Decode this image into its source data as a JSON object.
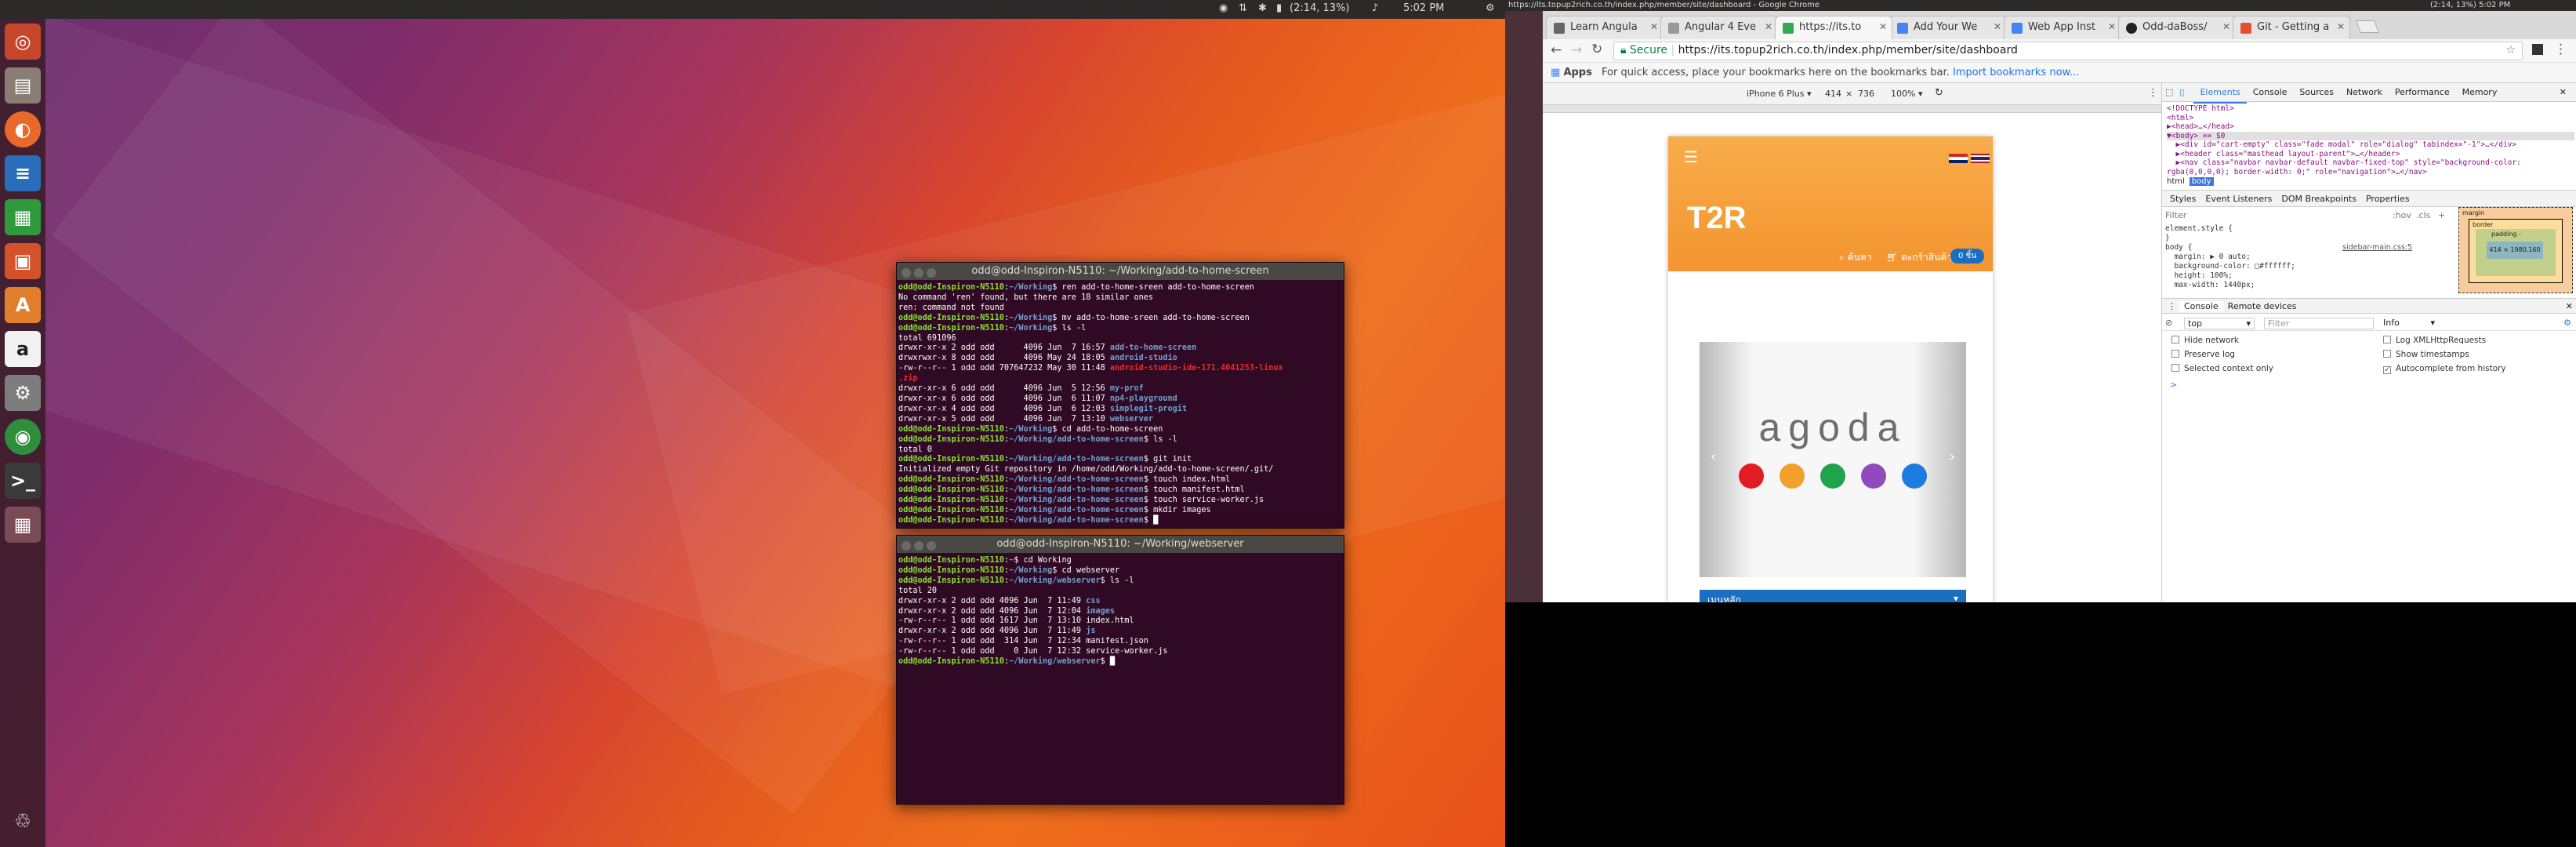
{
  "desktop": {
    "topbar": {
      "indicators": [
        "(2:14, 13%)",
        "5:02 PM"
      ]
    },
    "launcher_icons": [
      "dash-icon",
      "files-icon",
      "firefox-icon",
      "writer-icon",
      "calc-icon",
      "impress-icon",
      "software-center-icon",
      "amazon-icon",
      "settings-icon",
      "chrome-icon",
      "terminal-icon",
      "workspace-icon",
      "trash-icon"
    ]
  },
  "terminals": [
    {
      "title": "odd@odd-Inspiron-N5110: ~/Working/add-to-home-screen",
      "lines": [
        [
          {
            "c": "g",
            "t": "odd@odd-Inspiron-N5110"
          },
          {
            "t": ":"
          },
          {
            "c": "b",
            "t": "~/Working"
          },
          {
            "t": "$ ren add-to-home-sreen add-to-home-screen"
          }
        ],
        [
          {
            "t": "No command 'ren' found, but there are 18 similar ones"
          }
        ],
        [
          {
            "t": "ren: command not found"
          }
        ],
        [
          {
            "c": "g",
            "t": "odd@odd-Inspiron-N5110"
          },
          {
            "t": ":"
          },
          {
            "c": "b",
            "t": "~/Working"
          },
          {
            "t": "$ mv add-to-home-sreen add-to-home-screen"
          }
        ],
        [
          {
            "c": "g",
            "t": "odd@odd-Inspiron-N5110"
          },
          {
            "t": ":"
          },
          {
            "c": "b",
            "t": "~/Working"
          },
          {
            "t": "$ ls -l"
          }
        ],
        [
          {
            "t": "total 691096"
          }
        ],
        [
          {
            "t": "drwxr-xr-x 2 odd odd      4096 Jun  7 16:57 "
          },
          {
            "c": "b",
            "t": "add-to-home-screen"
          }
        ],
        [
          {
            "t": "drwxrwxr-x 8 odd odd      4096 May 24 18:05 "
          },
          {
            "c": "b",
            "t": "android-studio"
          }
        ],
        [
          {
            "t": "-rw-r--r-- 1 odd odd 707647232 May 30 11:48 "
          },
          {
            "c": "r",
            "t": "android-studio-ide-171.4041253-linux"
          }
        ],
        [
          {
            "c": "r",
            "t": ".zip"
          }
        ],
        [
          {
            "t": "drwxr-xr-x 6 odd odd      4096 Jun  5 12:56 "
          },
          {
            "c": "b",
            "t": "my-prof"
          }
        ],
        [
          {
            "t": "drwxr-xr-x 6 odd odd      4096 Jun  6 11:07 "
          },
          {
            "c": "b",
            "t": "np4-playground"
          }
        ],
        [
          {
            "t": "drwxr-xr-x 4 odd odd      4096 Jun  6 12:03 "
          },
          {
            "c": "b",
            "t": "simplegit-progit"
          }
        ],
        [
          {
            "t": "drwxr-xr-x 5 odd odd      4096 Jun  7 13:10 "
          },
          {
            "c": "b",
            "t": "webserver"
          }
        ],
        [
          {
            "c": "g",
            "t": "odd@odd-Inspiron-N5110"
          },
          {
            "t": ":"
          },
          {
            "c": "b",
            "t": "~/Working"
          },
          {
            "t": "$ cd add-to-home-screen"
          }
        ],
        [
          {
            "c": "g",
            "t": "odd@odd-Inspiron-N5110"
          },
          {
            "t": ":"
          },
          {
            "c": "b",
            "t": "~/Working/add-to-home-screen"
          },
          {
            "t": "$ ls -l"
          }
        ],
        [
          {
            "t": "total 0"
          }
        ],
        [
          {
            "c": "g",
            "t": "odd@odd-Inspiron-N5110"
          },
          {
            "t": ":"
          },
          {
            "c": "b",
            "t": "~/Working/add-to-home-screen"
          },
          {
            "t": "$ git init"
          }
        ],
        [
          {
            "t": "Initialized empty Git repository in /home/odd/Working/add-to-home-screen/.git/"
          }
        ],
        [
          {
            "c": "g",
            "t": "odd@odd-Inspiron-N5110"
          },
          {
            "t": ":"
          },
          {
            "c": "b",
            "t": "~/Working/add-to-home-screen"
          },
          {
            "t": "$ touch index.html"
          }
        ],
        [
          {
            "c": "g",
            "t": "odd@odd-Inspiron-N5110"
          },
          {
            "t": ":"
          },
          {
            "c": "b",
            "t": "~/Working/add-to-home-screen"
          },
          {
            "t": "$ touch manifest.html"
          }
        ],
        [
          {
            "c": "g",
            "t": "odd@odd-Inspiron-N5110"
          },
          {
            "t": ":"
          },
          {
            "c": "b",
            "t": "~/Working/add-to-home-screen"
          },
          {
            "t": "$ touch service-worker.js"
          }
        ],
        [
          {
            "c": "g",
            "t": "odd@odd-Inspiron-N5110"
          },
          {
            "t": ":"
          },
          {
            "c": "b",
            "t": "~/Working/add-to-home-screen"
          },
          {
            "t": "$ mkdir images"
          }
        ],
        [
          {
            "c": "g",
            "t": "odd@odd-Inspiron-N5110"
          },
          {
            "t": ":"
          },
          {
            "c": "b",
            "t": "~/Working/add-to-home-screen"
          },
          {
            "t": "$ █"
          }
        ]
      ]
    },
    {
      "title": "odd@odd-Inspiron-N5110: ~/Working/webserver",
      "lines": [
        [
          {
            "c": "g",
            "t": "odd@odd-Inspiron-N5110"
          },
          {
            "t": ":"
          },
          {
            "c": "b",
            "t": "~"
          },
          {
            "t": "$ cd Working"
          }
        ],
        [
          {
            "c": "g",
            "t": "odd@odd-Inspiron-N5110"
          },
          {
            "t": ":"
          },
          {
            "c": "b",
            "t": "~/Working"
          },
          {
            "t": "$ cd webserver"
          }
        ],
        [
          {
            "c": "g",
            "t": "odd@odd-Inspiron-N5110"
          },
          {
            "t": ":"
          },
          {
            "c": "b",
            "t": "~/Working/webserver"
          },
          {
            "t": "$ ls -l"
          }
        ],
        [
          {
            "t": "total 20"
          }
        ],
        [
          {
            "t": "drwxr-xr-x 2 odd odd 4096 Jun  7 11:49 "
          },
          {
            "c": "b",
            "t": "css"
          }
        ],
        [
          {
            "t": "drwxr-xr-x 2 odd odd 4096 Jun  7 12:04 "
          },
          {
            "c": "b",
            "t": "images"
          }
        ],
        [
          {
            "t": "-rw-r--r-- 1 odd odd 1617 Jun  7 13:10 index.html"
          }
        ],
        [
          {
            "t": "drwxr-xr-x 2 odd odd 4096 Jun  7 11:49 "
          },
          {
            "c": "b",
            "t": "js"
          }
        ],
        [
          {
            "t": "-rw-r--r-- 1 odd odd  314 Jun  7 12:34 manifest.json"
          }
        ],
        [
          {
            "t": "-rw-r--r-- 1 odd odd    0 Jun  7 12:32 service-worker.js"
          }
        ],
        [
          {
            "c": "g",
            "t": "odd@odd-Inspiron-N5110"
          },
          {
            "t": ":"
          },
          {
            "c": "b",
            "t": "~/Working/webserver"
          },
          {
            "t": "$ █"
          }
        ]
      ]
    }
  ],
  "chrome": {
    "window_title": "https://its.topup2rich.co.th/index.php/member/site/dashboard - Google Chrome",
    "indicators": "(2:14, 13%)   5:02 PM",
    "tabs": [
      {
        "label": "Learn Angula",
        "color": "#666"
      },
      {
        "label": "Angular 4 Eve",
        "color": "#999"
      },
      {
        "label": "https://its.to",
        "color": "#34a853"
      },
      {
        "label": "Add Your We",
        "color": "#4285f4"
      },
      {
        "label": "Web App Inst",
        "color": "#4285f4"
      },
      {
        "label": "Odd-daBoss/",
        "color": "#222"
      },
      {
        "label": "Git - Getting a",
        "color": "#e94e31"
      }
    ],
    "secure_label": "Secure",
    "url": "https://its.topup2rich.co.th/index.php/member/site/dashboard",
    "bookmarks_apps": "Apps",
    "bookmarks_hint": "For quick access, place your bookmarks here on the bookmarks bar.",
    "bookmarks_link": "Import bookmarks now...",
    "device": {
      "name": "iPhone 6 Plus ▾",
      "width": "414",
      "x": "×",
      "height": "736",
      "zoom": "100% ▾"
    },
    "page": {
      "brand": "T2R",
      "search_text": "ค้นหา",
      "cart_text": "ตะกร้าสินค้า",
      "cart_badge": "0 ชิ้น",
      "banner_text": "agoda",
      "banner_dots": [
        "#e31b23",
        "#f3a02b",
        "#1fa44c",
        "#8f4bbd",
        "#1e7be0"
      ],
      "bottom_bar": "เมนูหลัก"
    },
    "devtools": {
      "tabs": [
        "Elements",
        "Console",
        "Sources",
        "Network",
        "Performance",
        "Memory"
      ],
      "dom_lines": [
        "<!DOCTYPE html>",
        "<html>",
        "▶<head>…</head>",
        "▼<body> == $0",
        "  ▶<div id=\"cart-empty\" class=\"fade modal\" role=\"dialog\" tabindex=\"-1\">…</div>",
        "  ▶<header class=\"masthead layout-parent\">…</header>",
        "  ▶<nav class=\"navbar navbar-default navbar-fixed-top\" style=\"background-color:",
        "rgba(0,0,0,0); border-width: 0;\" role=\"navigation\">…</nav>"
      ],
      "breadcrumb": [
        "html",
        "body"
      ],
      "style_tabs": [
        "Styles",
        "Event Listeners",
        "DOM Breakpoints",
        "Properties"
      ],
      "filter": "Filter",
      "hov": ":hov",
      "cls": ".cls",
      "rules": [
        "element.style {",
        "}",
        "body {",
        "  margin: ▶ 0 auto;",
        "  background-color: □#ffffff;",
        "  height: 100%;",
        "  max-width: 1440px;"
      ],
      "rule_source": "sidebar-main.css:5",
      "box": {
        "margin": "margin",
        "border": "border",
        "padding": "padding -",
        "content": "414 × 1980.160",
        "dash": "-"
      },
      "console_tabs": [
        "Console",
        "Remote devices"
      ],
      "console_context": "top",
      "console_filter": "Filter",
      "console_level": "Info",
      "options_left": [
        "Hide network",
        "Preserve log",
        "Selected context only"
      ],
      "options_right": [
        "Log XMLHttpRequests",
        "Show timestamps",
        "Autocomplete from history"
      ],
      "prompt": ">"
    }
  }
}
